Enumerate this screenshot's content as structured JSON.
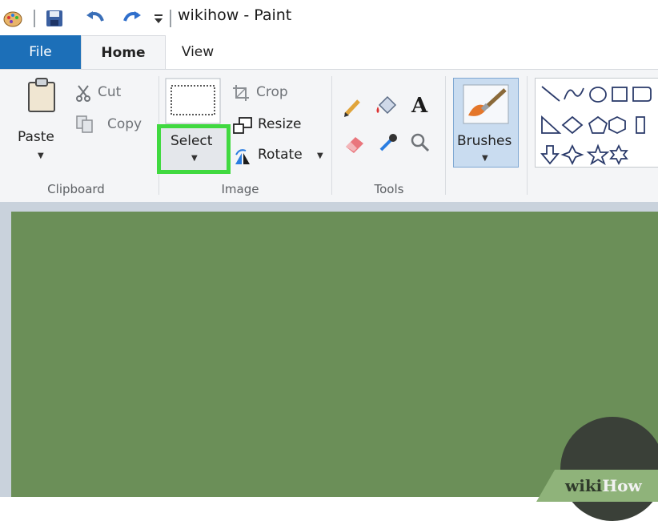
{
  "window": {
    "title": "wikihow - Paint"
  },
  "quick_access": {
    "icons": [
      "paint-app-icon",
      "save-icon",
      "undo-icon",
      "redo-icon",
      "customize-dropdown-icon"
    ]
  },
  "tabs": [
    {
      "label": "File"
    },
    {
      "label": "Home"
    },
    {
      "label": "View"
    }
  ],
  "ribbon": {
    "clipboard": {
      "paste": "Paste",
      "cut": "Cut",
      "copy": "Copy",
      "group_label": "Clipboard"
    },
    "image": {
      "select": "Select",
      "crop": "Crop",
      "resize": "Resize",
      "rotate": "Rotate",
      "group_label": "Image"
    },
    "tools": {
      "group_label": "Tools",
      "icons": [
        "pencil-icon",
        "fill-icon",
        "text-icon",
        "eraser-icon",
        "color-picker-icon",
        "magnifier-icon"
      ]
    },
    "brushes": {
      "label": "Brushes"
    }
  },
  "canvas": {
    "color": "#6b8f58"
  },
  "colors": {
    "file_tab": "#1c6fb8",
    "highlight": "#40d940",
    "ribbon_bg": "#f4f5f7",
    "brushes_bg": "#c9dcf0"
  },
  "watermark": {
    "wiki": "wiki",
    "how": "How"
  }
}
